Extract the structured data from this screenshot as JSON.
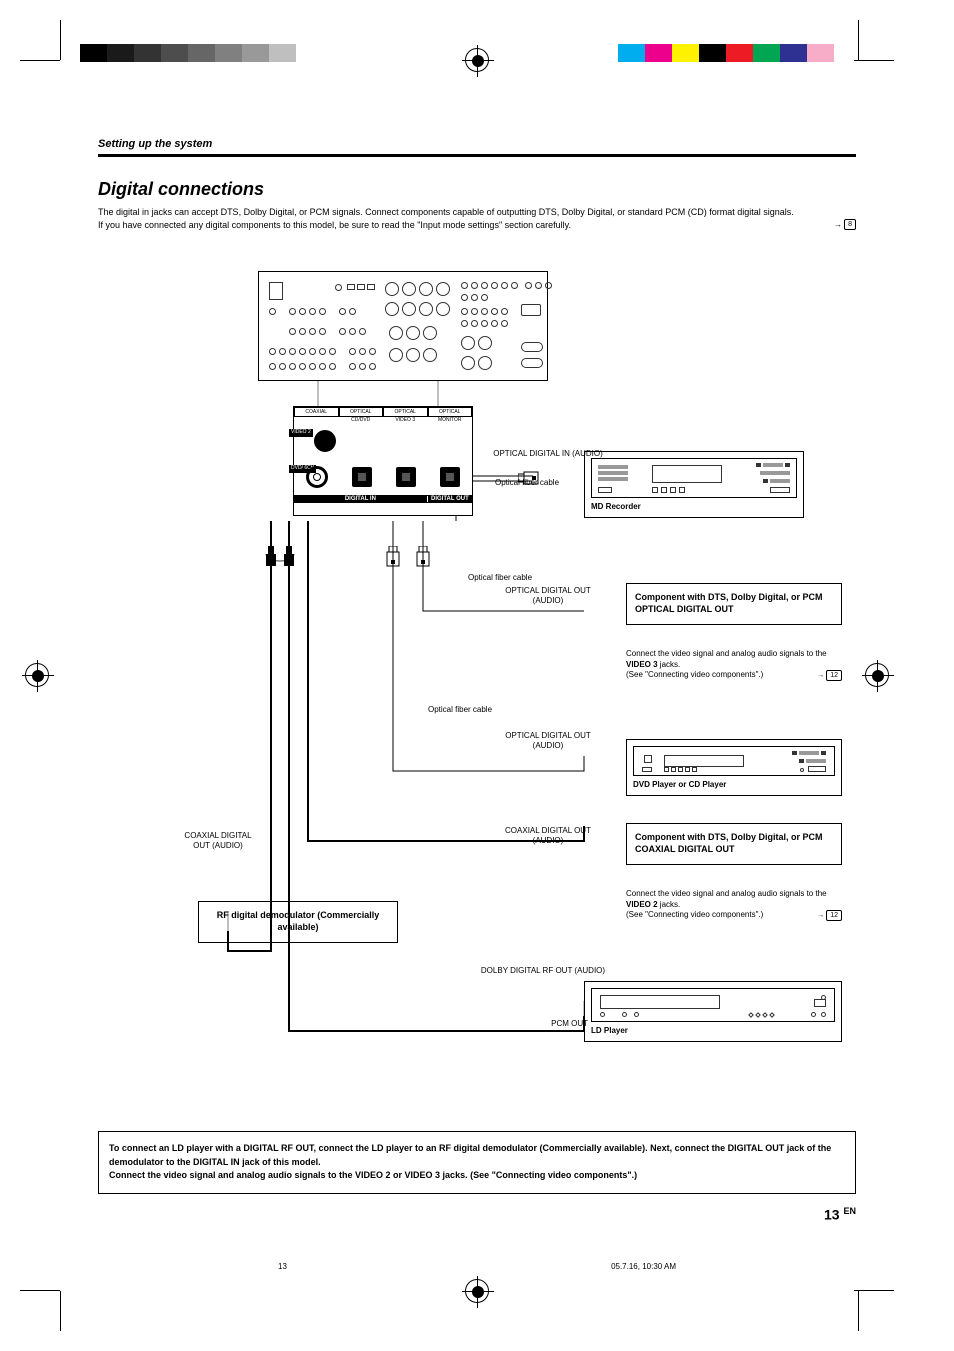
{
  "section_header": "Setting up the system",
  "title": "Digital connections",
  "intro_line1": "The digital in jacks can accept DTS, Dolby Digital, or PCM signals. Connect components capable of outputting DTS, Dolby Digital, or standard PCM (CD) format digital signals.",
  "intro_line2": "If you have connected any digital components to this model, be sure to read the \"Input mode settings\" section carefully.",
  "pageref_top": "8",
  "panel": {
    "col1": "COAXIAL",
    "col2": "OPTICAL",
    "col3": "OPTICAL",
    "col4": "OPTICAL",
    "sub2": "CD/DVD",
    "sub3": "VIDEO 3",
    "sub4": "MONITOR",
    "side1": "VIDEO 2",
    "side2": "DVD/ 6CH",
    "row_in": "DIGITAL IN",
    "row_out": "DIGITAL OUT"
  },
  "labels": {
    "opt_in": "OPTICAL DIGITAL IN (AUDIO)",
    "opt_cable": "Optical fiber cable",
    "opt_cable2": "Optical fiber cable",
    "opt_out": "OPTICAL DIGITAL OUT (AUDIO)",
    "opt_out2": "OPTICAL DIGITAL OUT (AUDIO)",
    "coax_out": "COAXIAL DIGITAL OUT (AUDIO)",
    "coax_out_left": "COAXIAL DIGITAL OUT (AUDIO)",
    "dolby_rf": "DOLBY DIGITAL RF OUT (AUDIO)",
    "pcm_out": "PCM OUT"
  },
  "devices": {
    "md": "MD Recorder",
    "dvd": "DVD Player or CD Player",
    "ld": "LD Player"
  },
  "components": {
    "opt": "Component with DTS, Dolby Digital, or PCM OPTICAL DIGITAL OUT",
    "coax": "Component with DTS, Dolby Digital, or PCM COAXIAL DIGITAL OUT"
  },
  "notes": {
    "video3_a": "Connect the video signal and analog audio signals to the ",
    "video3_b": "VIDEO 3",
    "video3_c": " jacks.",
    "video3_d": "(See \"Connecting video components\".)",
    "video2_a": "Connect the video signal and analog audio signals to the ",
    "video2_b": "VIDEO 2",
    "video2_c": " jacks.",
    "video2_d": "(See \"Connecting video components\".)",
    "ref12": "12"
  },
  "demod": "RF digital demodulator (Commercially available)",
  "bottom_note": "To connect an LD player with a DIGITAL RF OUT, connect the LD player to an RF digital demodulator (Commercially available). Next, connect the DIGITAL OUT jack of the demodulator to the DIGITAL IN jack of this model.\nConnect the video signal and analog audio signals to the VIDEO 2  or VIDEO 3 jacks. (See \"Connecting video components\".)",
  "page_number": "13",
  "page_suffix": "EN",
  "footer_page": "13",
  "footer_date": "05.7.16, 10:30 AM"
}
